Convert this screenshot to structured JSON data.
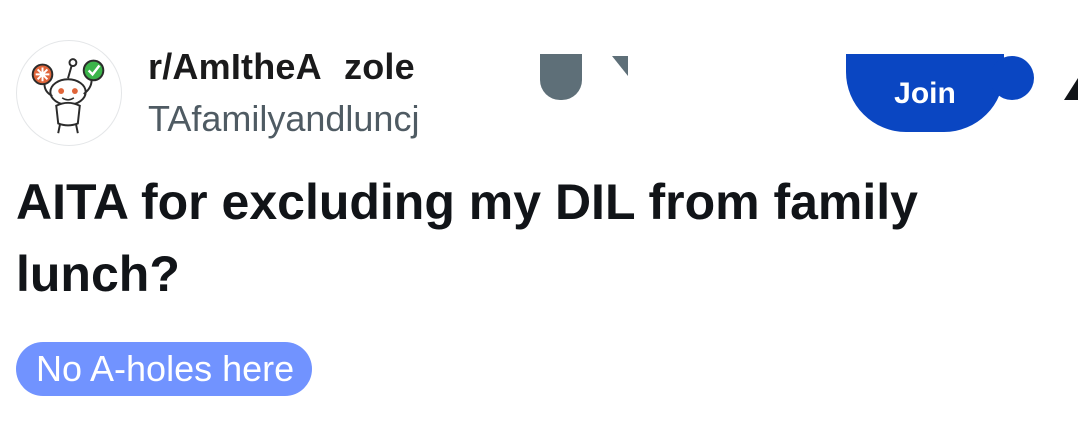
{
  "post": {
    "subreddit": "r/AmItheA   zole",
    "author": "TAfamilyandluncj",
    "title": "AITA for excluding my DIL from family lunch?",
    "flair": "No A-holes here",
    "join_label": "Join"
  },
  "icons": {
    "avatar": "snoo-mascot-icon",
    "join": "join-button",
    "more": "overflow-icon"
  },
  "colors": {
    "join_blue": "#0a46c2",
    "flair_blue": "#7193ff",
    "author_gray": "#4f5b63",
    "glitch_gray": "#5e6f78"
  }
}
